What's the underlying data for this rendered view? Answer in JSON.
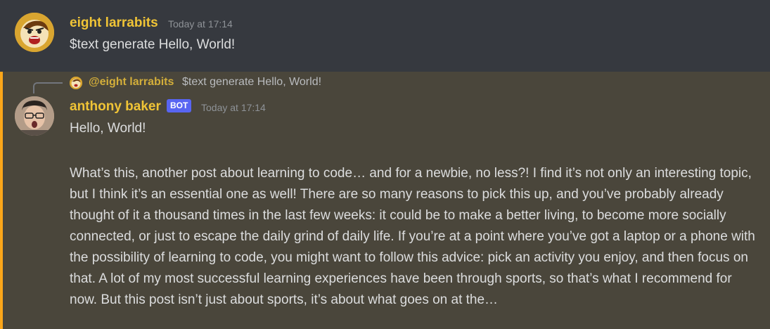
{
  "message1": {
    "username": "eight larrabits",
    "timestamp": "Today at 17:14",
    "content": "$text generate Hello, World!",
    "avatar_icon": "angry-cartoon-face-icon"
  },
  "message2": {
    "reply": {
      "mention": "@eight larrabits",
      "text": "$text generate Hello, World!"
    },
    "username": "anthony baker",
    "bot_tag": "BOT",
    "timestamp": "Today at 17:14",
    "line1": "Hello, World!",
    "paragraph": "What’s this, another post about learning to code… and for a newbie, no less?! I find it’s not only an interesting topic, but I think it’s an essential one as well! There are so many reasons to pick this up, and you’ve probably already thought of it a thousand times in the last few weeks: it could be to make a better living, to become more socially connected, or just to escape the daily grind of daily life. If you’re at a point where you’ve got a laptop or a phone with the possibility of learning to code, you might want to follow this advice: pick an activity you enjoy, and then focus on that. A lot of my most successful learning experiences have been through sports, so that’s what I recommend for now. But this post isn’t just about sports, it’s about what goes on at the…",
    "avatar_icon": "user-photo-avatar"
  },
  "colors": {
    "background": "#36393f",
    "highlight_background": "#4a463b",
    "highlight_border": "#faa61a",
    "username": "#f0c436",
    "bot_tag": "#5865f2"
  }
}
